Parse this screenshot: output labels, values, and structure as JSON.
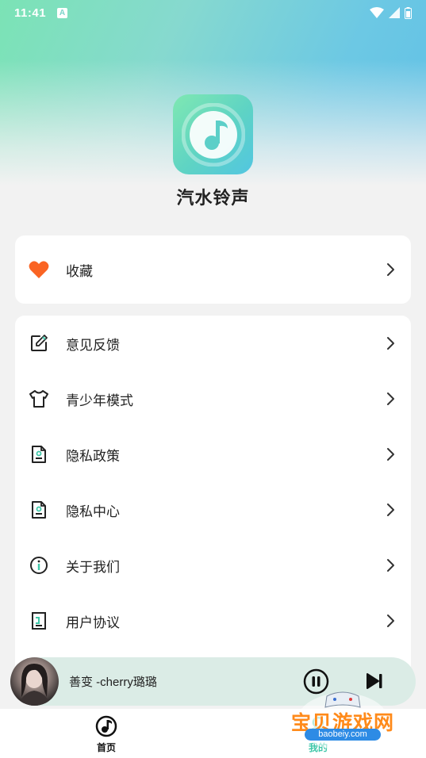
{
  "status_bar": {
    "time": "11:41",
    "notification_badge": "A"
  },
  "app": {
    "name": "汽水铃声"
  },
  "favorites": {
    "label": "收藏",
    "icon": "heart-icon",
    "icon_color": "#fa6423"
  },
  "menu": [
    {
      "label": "意见反馈",
      "icon": "edit-icon"
    },
    {
      "label": "青少年模式",
      "icon": "tshirt-icon"
    },
    {
      "label": "隐私政策",
      "icon": "document-icon"
    },
    {
      "label": "隐私中心",
      "icon": "document-icon"
    },
    {
      "label": "关于我们",
      "icon": "info-icon"
    },
    {
      "label": "用户协议",
      "icon": "agreement-icon"
    }
  ],
  "player": {
    "track": "善变 -cherry璐璐"
  },
  "bottom_nav": [
    {
      "label": "首页",
      "icon": "music-note-icon",
      "active": false
    },
    {
      "label": "我的",
      "icon": "user-icon",
      "active": true
    }
  ],
  "watermark": {
    "title": "宝贝游戏网",
    "url": "baobeiy.com"
  },
  "colors": {
    "accent": "#3fc7a9",
    "gradient_start": "#7be3b5",
    "gradient_end": "#5fbfe6"
  }
}
